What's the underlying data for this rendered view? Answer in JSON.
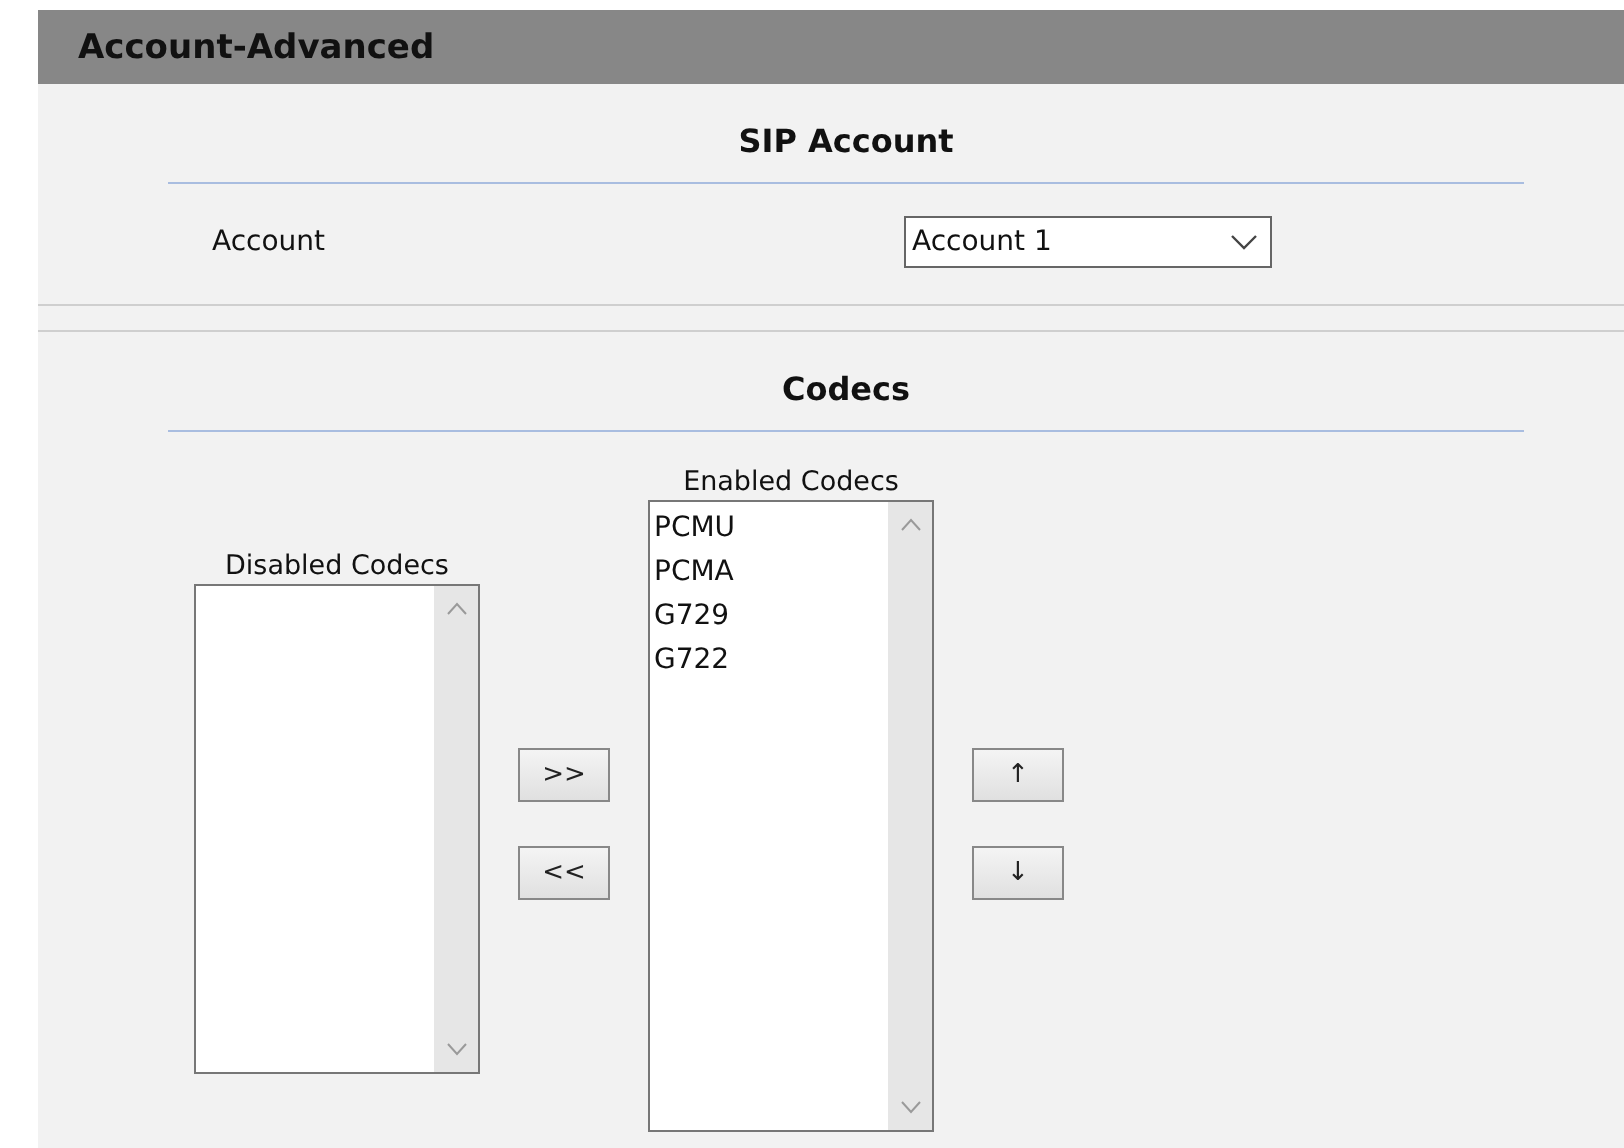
{
  "page_title": "Account-Advanced",
  "sip_account": {
    "title": "SIP Account",
    "account_label": "Account",
    "account_value": "Account 1"
  },
  "codecs": {
    "title": "Codecs",
    "disabled_label": "Disabled Codecs",
    "enabled_label": "Enabled Codecs",
    "enabled_items": [
      "PCMU",
      "PCMA",
      "G729",
      "G722"
    ],
    "move_buttons": [
      ">>",
      "<<"
    ],
    "order_buttons": [
      "↑",
      "↓"
    ]
  }
}
